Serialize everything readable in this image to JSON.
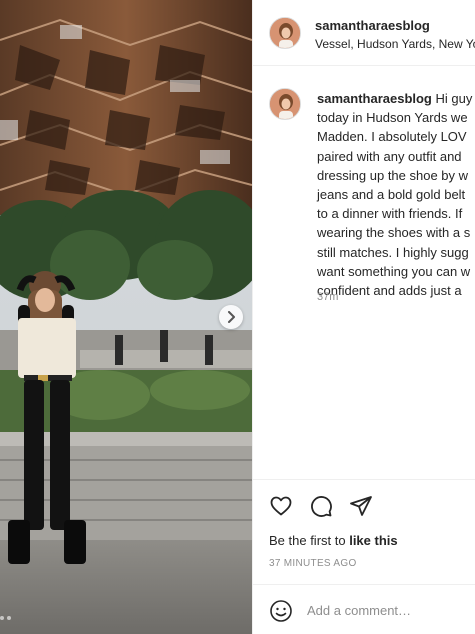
{
  "post": {
    "username": "samantharaesblog",
    "location": "Vessel, Hudson Yards, New York",
    "caption_lines": [
      "Hi guys! Today I was out",
      "today in Hudson Yards wearing",
      "Madden. I absolutely LOVE",
      "paired with any outfit and",
      "dressing up the shoe by wearing",
      "jeans and a bold gold belt",
      "to a dinner with friends. If",
      "wearing the shoes with a s",
      "still matches. I highly sugg",
      "want something you can w",
      "confident and adds just a"
    ],
    "time_ago": "37m",
    "likes_prefix": "Be the first to ",
    "likes_link": "like this",
    "posted_time": "37 MINUTES AGO",
    "carousel_dots": 3
  },
  "caption_visible": {
    "line0": "Hi guy",
    "line1": "today in Hudson Yards we",
    "line2": "Madden. I absolutely LOV",
    "line3": "paired with any outfit and",
    "line4": "dressing up the shoe by w",
    "line5": "jeans and a bold gold belt",
    "line6": "to a dinner with friends. If",
    "line7": "wearing the shoes with a s",
    "line8": "still matches. I highly sugg",
    "line9": "want something you can w",
    "line10": "confident and adds just a"
  },
  "comment": {
    "placeholder": "Add a comment…"
  },
  "icons": {
    "like": "heart-icon",
    "comment": "speech-bubble-icon",
    "share": "paper-plane-icon",
    "emoji": "smiley-icon",
    "next": "chevron-right-icon"
  },
  "colors": {
    "text": "#262626",
    "muted": "#8e8e8e",
    "border": "#efefef"
  }
}
